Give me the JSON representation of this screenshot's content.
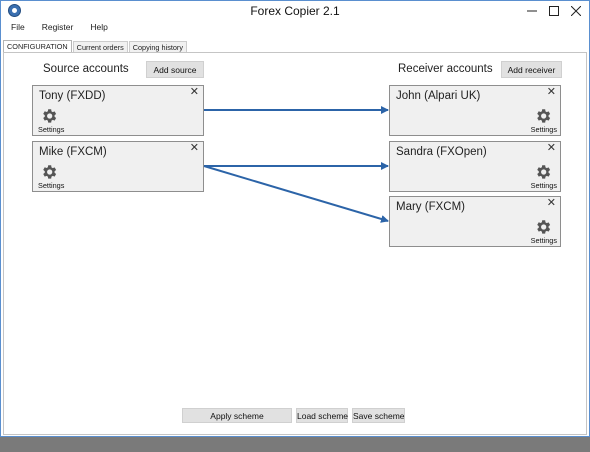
{
  "window": {
    "title": "Forex Copier 2.1"
  },
  "menu": [
    "File",
    "Register",
    "Help"
  ],
  "tabs": [
    "CONFIGURATION",
    "Current orders",
    "Copying history"
  ],
  "source": {
    "title": "Source accounts",
    "add_label": "Add source",
    "accounts": [
      {
        "name": "Tony (FXDD)",
        "settings_label": "Settings"
      },
      {
        "name": "Mike (FXCM)",
        "settings_label": "Settings"
      }
    ]
  },
  "receiver": {
    "title": "Receiver accounts",
    "add_label": "Add receiver",
    "accounts": [
      {
        "name": "John (Alpari UK)",
        "settings_label": "Settings"
      },
      {
        "name": "Sandra (FXOpen)",
        "settings_label": "Settings"
      },
      {
        "name": "Mary (FXCM)",
        "settings_label": "Settings"
      }
    ]
  },
  "links": [
    {
      "from": "Tony (FXDD)",
      "to": "John (Alpari UK)"
    },
    {
      "from": "Mike (FXCM)",
      "to": "Sandra (FXOpen)"
    },
    {
      "from": "Mike (FXCM)",
      "to": "Mary (FXCM)"
    }
  ],
  "footer": {
    "apply_label": "Apply scheme",
    "load_label": "Load scheme",
    "save_label": "Save scheme"
  },
  "colors": {
    "link_arrow": "#2c64a8",
    "card_bg": "#f0f0f0",
    "card_border": "#8e8e8e",
    "button_bg": "#e1e1e1"
  }
}
